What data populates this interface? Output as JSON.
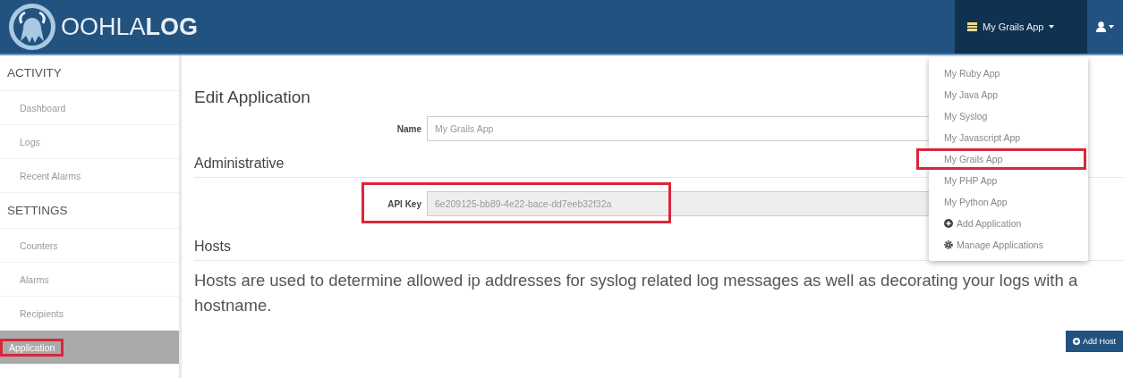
{
  "header": {
    "logo_text": "OOHLA",
    "logo_text_bold": "LOG",
    "app_menu": {
      "label": "My Grails App",
      "expanded": true
    }
  },
  "app_dropdown": [
    {
      "kind": "app",
      "label": "My Ruby App",
      "highlighted": false
    },
    {
      "kind": "app",
      "label": "My Java App",
      "highlighted": false
    },
    {
      "kind": "app",
      "label": "My Syslog",
      "highlighted": false
    },
    {
      "kind": "app",
      "label": "My Javascript App",
      "highlighted": false
    },
    {
      "kind": "app",
      "label": "My Grails App",
      "highlighted": true
    },
    {
      "kind": "app",
      "label": "My PHP App",
      "highlighted": false
    },
    {
      "kind": "app",
      "label": "My Python App",
      "highlighted": false
    },
    {
      "kind": "add",
      "label": "Add Application",
      "highlighted": false
    },
    {
      "kind": "manage",
      "label": "Manage Applications",
      "highlighted": false
    }
  ],
  "sidebar": [
    {
      "kind": "heading",
      "label": "ACTIVITY"
    },
    {
      "kind": "item",
      "label": "Dashboard",
      "selected": false,
      "highlighted": false
    },
    {
      "kind": "item",
      "label": "Logs",
      "selected": false,
      "highlighted": false
    },
    {
      "kind": "item",
      "label": "Recent Alarms",
      "selected": false,
      "highlighted": false
    },
    {
      "kind": "heading",
      "label": "SETTINGS"
    },
    {
      "kind": "item",
      "label": "Counters",
      "selected": false,
      "highlighted": false
    },
    {
      "kind": "item",
      "label": "Alarms",
      "selected": false,
      "highlighted": false
    },
    {
      "kind": "item",
      "label": "Recipients",
      "selected": false,
      "highlighted": false
    },
    {
      "kind": "item",
      "label": "Application",
      "selected": true,
      "highlighted": true
    }
  ],
  "content": {
    "title": "Edit Application",
    "name_field": {
      "label": "Name",
      "value": "My Grails App"
    },
    "admin_heading": "Administrative",
    "api_key_field": {
      "label": "API Key",
      "value": "6e209125-bb89-4e22-bace-dd7eeb32f32a",
      "disabled": true,
      "highlighted": true
    },
    "hosts_heading": "Hosts",
    "hosts_text": "Hosts are used to determine allowed ip addresses for syslog related log messages as well as decorating your logs with a hostname.",
    "add_host_button": "Add Host"
  }
}
